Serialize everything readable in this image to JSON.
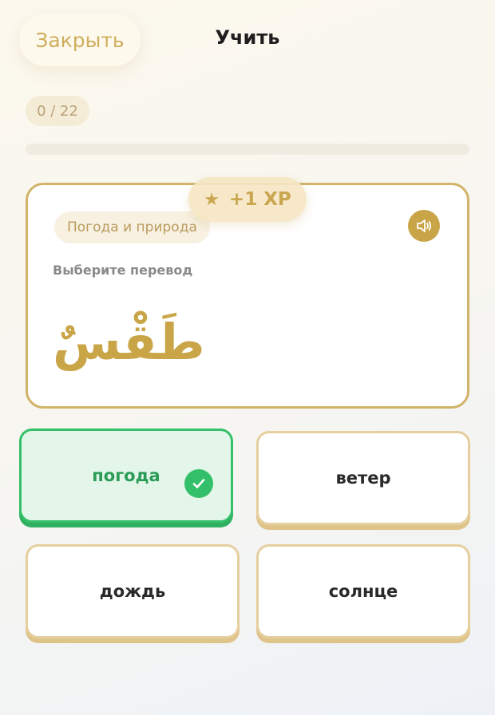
{
  "header": {
    "close_label": "Закрыть",
    "title": "Учить"
  },
  "progress": {
    "text": "0 / 22",
    "fraction": 0.0
  },
  "xp_badge": {
    "icon": "star-icon",
    "label": "+1 XP"
  },
  "card": {
    "category": "Погода и природа",
    "prompt": "Выберите перевод",
    "word": "طَقْسٌ",
    "sound_icon": "speaker-icon"
  },
  "options": [
    {
      "label": "погода",
      "state": "correct"
    },
    {
      "label": "ветер",
      "state": "default"
    },
    {
      "label": "дождь",
      "state": "default"
    },
    {
      "label": "солнце",
      "state": "default"
    }
  ],
  "colors": {
    "accent": "#c9a548",
    "correct": "#34c06a"
  }
}
